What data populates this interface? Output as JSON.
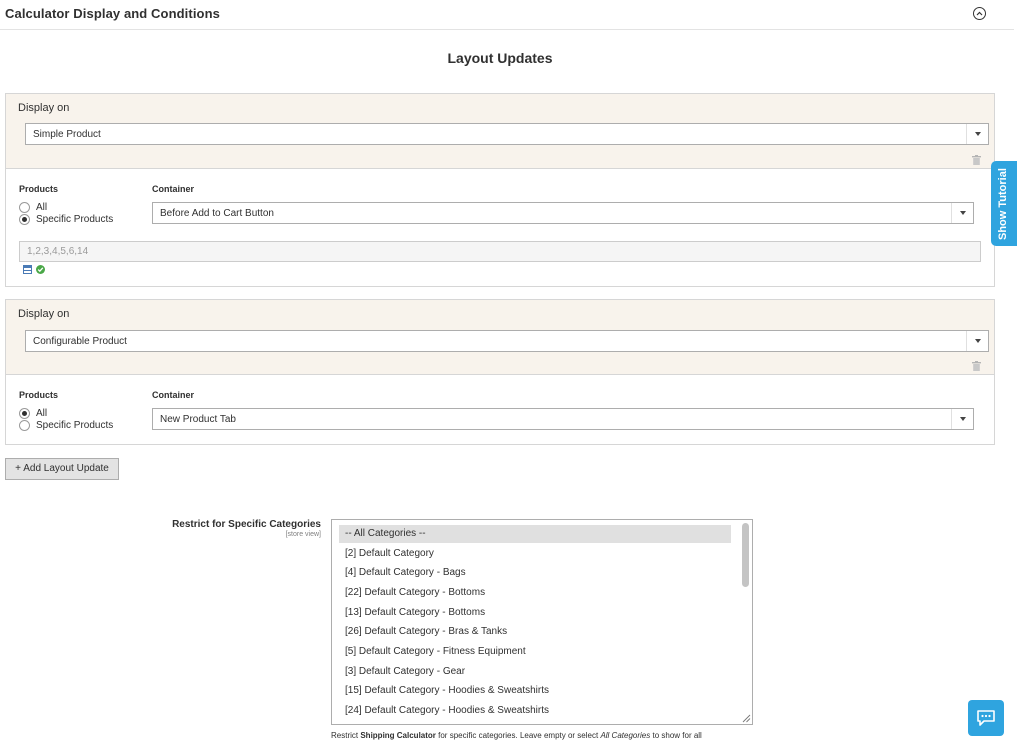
{
  "section": {
    "title": "Calculator Display and Conditions"
  },
  "layout_updates": {
    "title": "Layout Updates",
    "blocks": [
      {
        "display_on_label": "Display on",
        "display_on_value": "Simple Product",
        "products_label": "Products",
        "container_label": "Container",
        "radio_all": "All",
        "radio_specific": "Specific Products",
        "selected": "specific",
        "container_value": "Before Add to Cart Button",
        "product_ids": "1,2,3,4,5,6,14"
      },
      {
        "display_on_label": "Display on",
        "display_on_value": "Configurable Product",
        "products_label": "Products",
        "container_label": "Container",
        "radio_all": "All",
        "radio_specific": "Specific Products",
        "selected": "all",
        "container_value": "New Product Tab"
      }
    ],
    "add_button": "+ Add Layout Update"
  },
  "restrict": {
    "label": "Restrict for Specific Categories",
    "scope": "[store view]",
    "options": [
      "-- All Categories --",
      "[2] Default Category",
      "[4] Default Category - Bags",
      "[22] Default Category - Bottoms",
      "[13] Default Category - Bottoms",
      "[26] Default Category - Bras & Tanks",
      "[5] Default Category - Fitness Equipment",
      "[3] Default Category - Gear",
      "[15] Default Category - Hoodies & Sweatshirts",
      "[24] Default Category - Hoodies & Sweatshirts"
    ],
    "selected_index": 0,
    "note_prefix": "Restrict ",
    "note_bold": "Shipping Calculator",
    "note_middle": " for specific categories. Leave empty or select ",
    "note_italic": "All Categories",
    "note_suffix": " to show for all"
  },
  "tutorial_tab": "Show Tutorial",
  "colors": {
    "accent": "#2fa4df",
    "block_header_bg": "#f8f3ec",
    "check": "#4aa848"
  }
}
